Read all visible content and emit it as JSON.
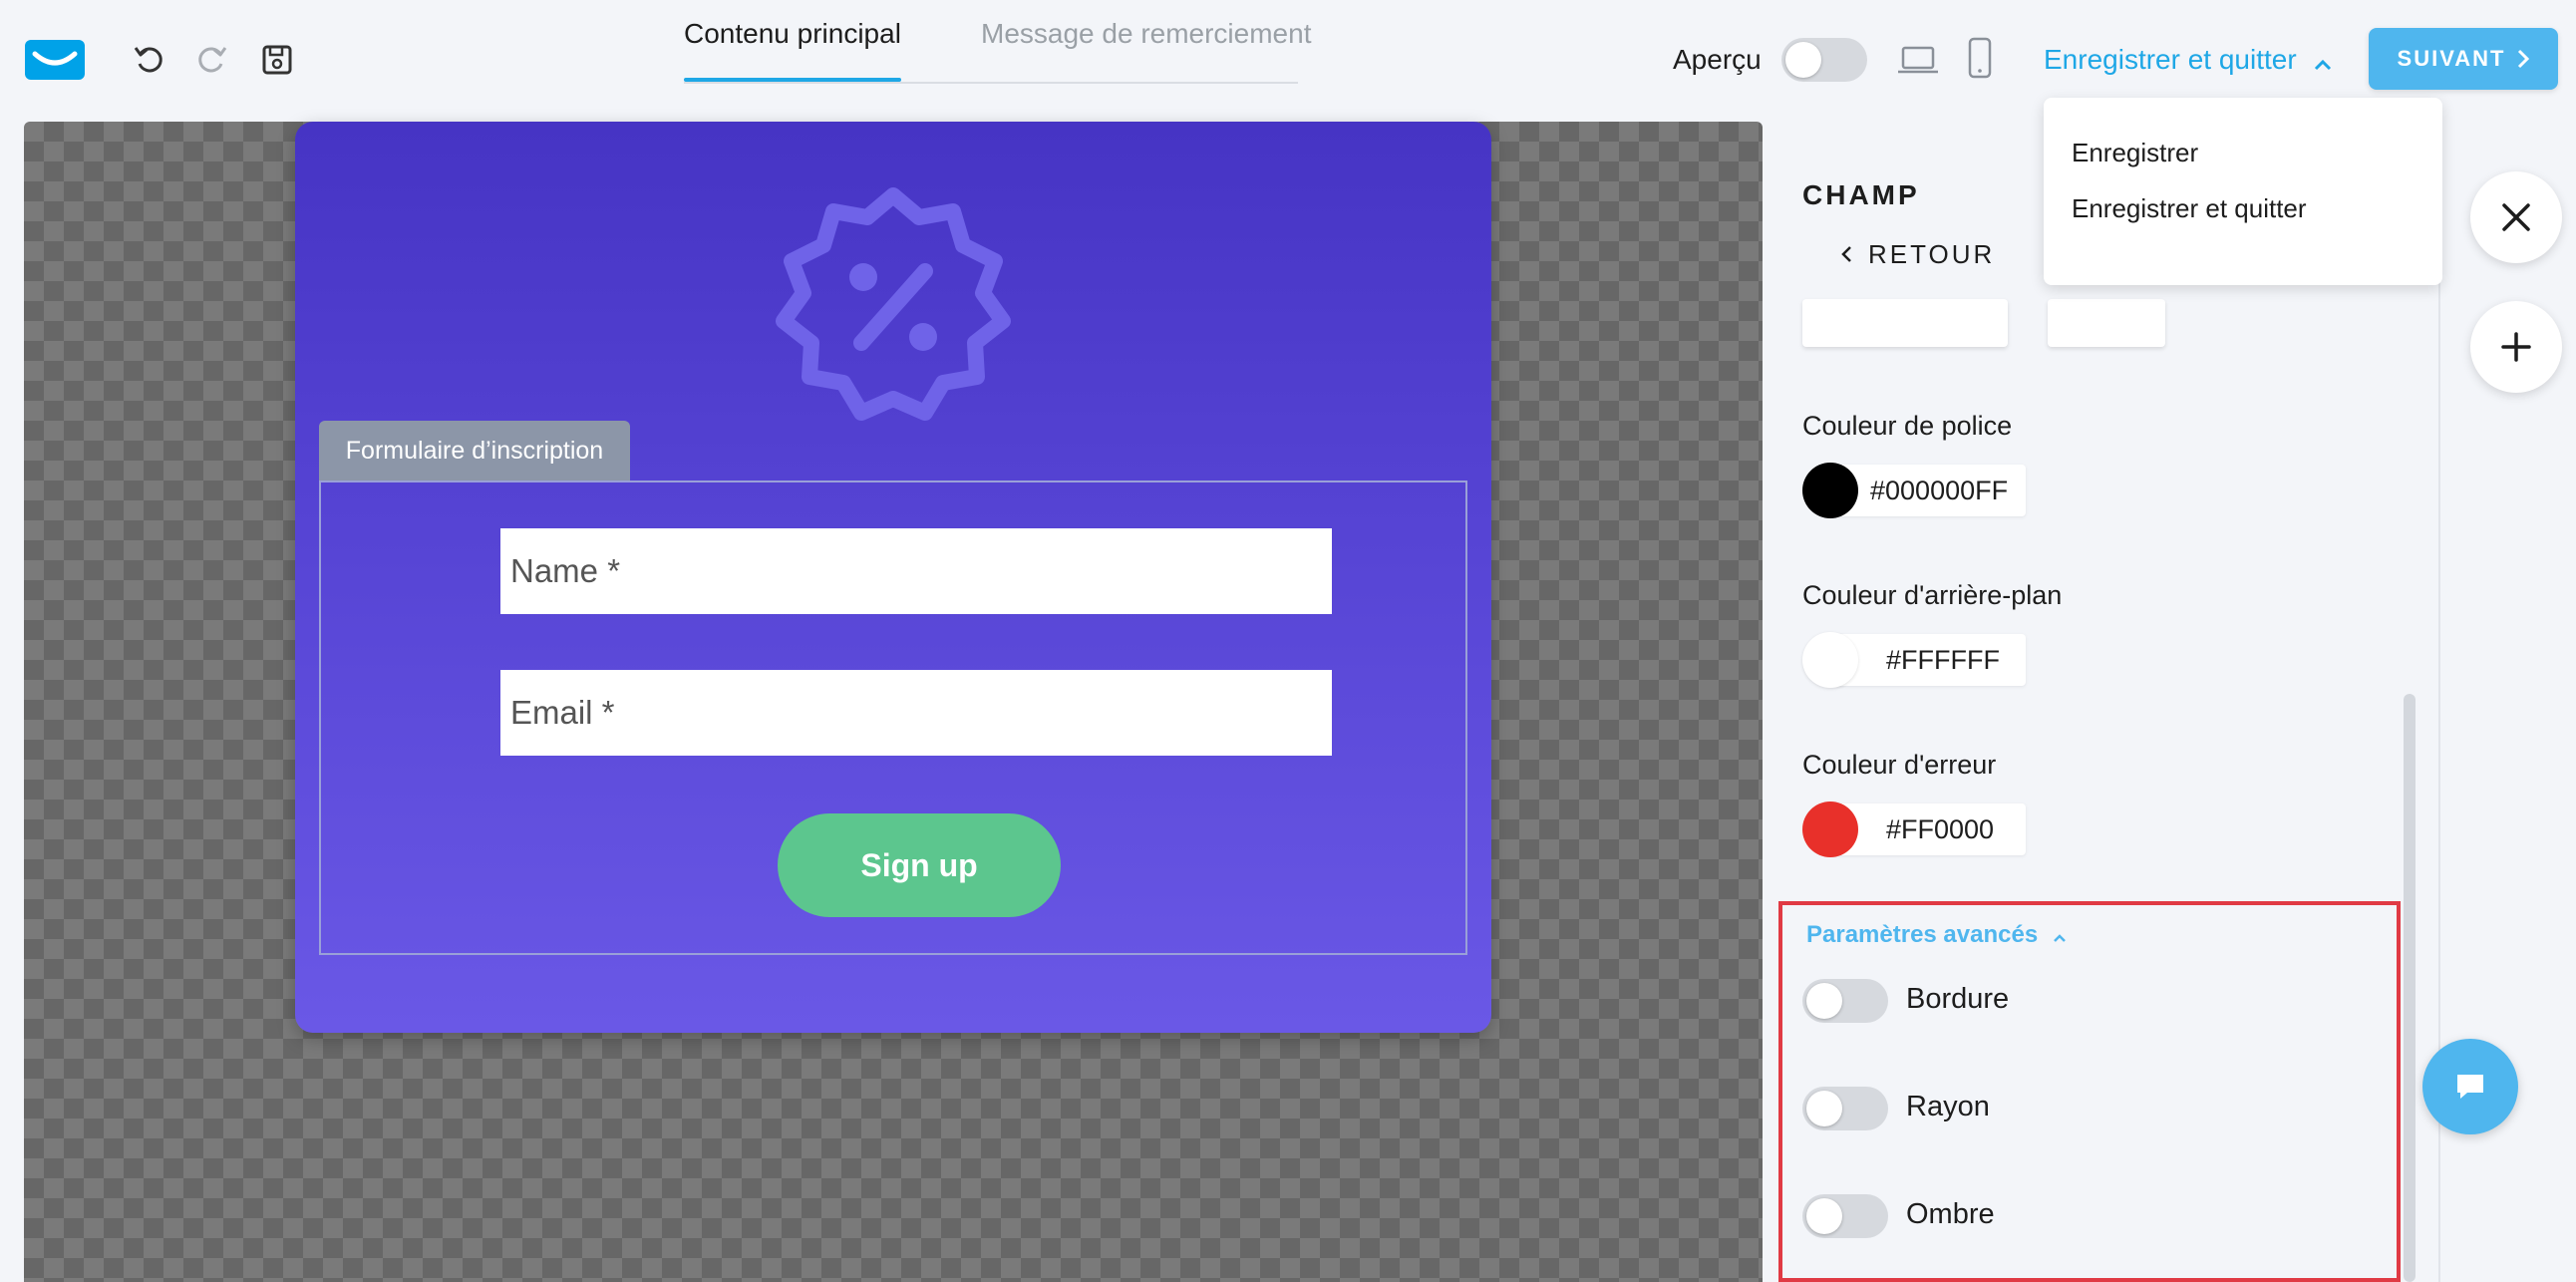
{
  "header": {
    "tabs": [
      {
        "label": "Contenu principal",
        "active": true
      },
      {
        "label": "Message de remerciement",
        "active": false
      }
    ],
    "preview_label": "Aperçu",
    "save_quit_label": "Enregistrer et quitter",
    "next_label": "SUIVANT",
    "icons": [
      "logo-icon",
      "undo-icon",
      "redo-icon",
      "save-icon",
      "laptop-icon",
      "mobile-icon",
      "chevron-up-icon",
      "chevron-right-icon"
    ]
  },
  "dropdown": {
    "items": [
      "Enregistrer",
      "Enregistrer et quitter"
    ]
  },
  "popup": {
    "form_tag": "Formulaire d’inscription",
    "name_placeholder": "Name *",
    "email_placeholder": "Email *",
    "signup_label": "Sign up"
  },
  "panel": {
    "section_title": "CHAMP",
    "back_label": "RETOUR",
    "font_color": {
      "label": "Couleur de police",
      "value": "#000000FF",
      "swatch": "#000000"
    },
    "bg_color": {
      "label": "Couleur d'arrière-plan",
      "value": "#FFFFFF",
      "swatch": "#FFFFFF"
    },
    "error_color": {
      "label": "Couleur d'erreur",
      "value": "#FF0000",
      "swatch": "#E8302A"
    },
    "advanced": {
      "title": "Paramètres avancés",
      "options": [
        {
          "label": "Bordure",
          "on": false
        },
        {
          "label": "Rayon",
          "on": false
        },
        {
          "label": "Ombre",
          "on": false
        }
      ]
    }
  },
  "colors": {
    "accent": "#1EA7E6",
    "popup_top": "#4634C4",
    "popup_bottom": "#6A58E6",
    "signup_button": "#5CC68E",
    "highlight_border": "#E03A44"
  }
}
